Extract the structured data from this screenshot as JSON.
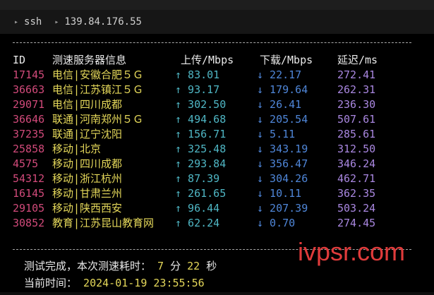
{
  "tab": {
    "first": "ssh",
    "second": "139.84.176.55"
  },
  "headers": {
    "id": "ID",
    "server": "测速服务器信息",
    "upload": "上传/Mbps",
    "download": "下载/Mbps",
    "latency": "延迟/ms"
  },
  "rows": [
    {
      "id": "17145",
      "server": "电信|安徽合肥５Ｇ",
      "upload": "↑ 83.01",
      "download": "↓ 22.17",
      "latency": "272.41"
    },
    {
      "id": "36663",
      "server": "电信|江苏镇江５Ｇ",
      "upload": "↑ 93.17",
      "download": "↓ 179.64",
      "latency": "262.31"
    },
    {
      "id": "29071",
      "server": "电信|四川成都",
      "upload": "↑ 302.50",
      "download": "↓ 26.41",
      "latency": "236.30"
    },
    {
      "id": "36646",
      "server": "联通|河南郑州５Ｇ",
      "upload": "↑ 494.68",
      "download": "↓ 205.54",
      "latency": "507.61"
    },
    {
      "id": "37235",
      "server": "联通|辽宁沈阳",
      "upload": "↑ 156.71",
      "download": "↓ 5.11",
      "latency": "285.61"
    },
    {
      "id": "25858",
      "server": "移动|北京",
      "upload": "↑ 325.48",
      "download": "↓ 343.19",
      "latency": "312.50"
    },
    {
      "id": "4575",
      "server": "移动|四川成都",
      "upload": "↑ 293.84",
      "download": "↓ 356.47",
      "latency": "346.24"
    },
    {
      "id": "54312",
      "server": "移动|浙江杭州",
      "upload": "↑ 87.39",
      "download": "↓ 304.26",
      "latency": "462.71"
    },
    {
      "id": "16145",
      "server": "移动|甘肃兰州",
      "upload": "↑ 261.65",
      "download": "↓ 10.11",
      "latency": "362.35"
    },
    {
      "id": "29105",
      "server": "移动|陕西西安",
      "upload": "↑ 96.44",
      "download": "↓ 207.39",
      "latency": "503.24"
    },
    {
      "id": "30852",
      "server": "教育|江苏昆山教育网",
      "upload": "↑ 62.24",
      "download": "↓ 0.70",
      "latency": "274.45"
    }
  ],
  "footer": {
    "done_text": "测试完成，本次测速耗时：",
    "minutes": "7",
    "min_unit": "分",
    "seconds": "22",
    "sec_unit": "秒",
    "time_label": "当前时间：",
    "timestamp": "2024-01-19 23:55:56"
  },
  "watermark": "ivpsr.com",
  "colors": {
    "background": "#000000",
    "id": "#d14a7a",
    "server": "#e5d85a",
    "upload": "#4fb6c4",
    "download": "#4f86d8",
    "latency": "#a987e0",
    "watermark": "#e03b3b"
  },
  "icons": {
    "tab_chevron": "chevron-right-icon"
  }
}
